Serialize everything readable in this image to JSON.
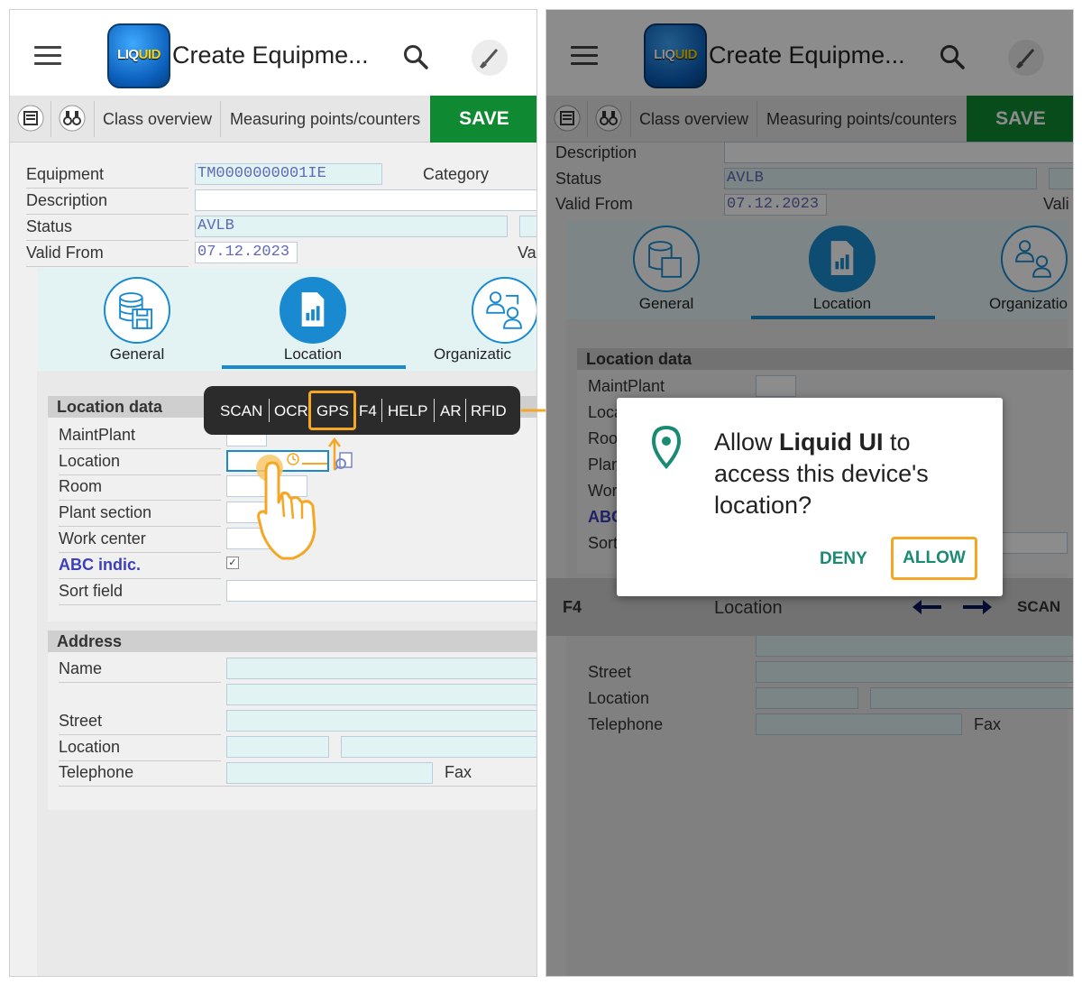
{
  "app": {
    "title": "Create Equipme...",
    "logo_text": "LIQUID"
  },
  "toolbar": {
    "class_overview": "Class overview",
    "measuring_points": "Measuring points/counters",
    "save_label": "SAVE"
  },
  "header_fields": {
    "equipment_label": "Equipment",
    "equipment_value": "TM0000000001IE",
    "category_label": "Category",
    "description_label": "Description",
    "status_label": "Status",
    "status_value": "AVLB",
    "valid_from_label": "Valid From",
    "valid_from_value": "07.12.2023",
    "valid_to_label_left": "Va",
    "valid_to_label_right": "Vali"
  },
  "tabs": [
    {
      "label": "General",
      "icon": "database-save-icon"
    },
    {
      "label": "Location",
      "icon": "document-chart-icon"
    },
    {
      "label": "Organizatic",
      "icon": "organization-icon"
    }
  ],
  "tabs_right": [
    {
      "label": "General"
    },
    {
      "label": "Location"
    },
    {
      "label": "Organizatio"
    }
  ],
  "location_data": {
    "header": "Location data",
    "maint_plant": "MaintPlant",
    "location": "Location",
    "room": "Room",
    "plant_section": "Plant section",
    "work_center": "Work center",
    "abc_indic": "ABC indic.",
    "sort_field": "Sort field"
  },
  "location_data_right": {
    "loc": "Loca",
    "room": "Roo",
    "plant": "Plan",
    "work": "Wor",
    "abc": "ABC",
    "sort": "Sort"
  },
  "address": {
    "header": "Address",
    "name": "Name",
    "street": "Street",
    "location": "Location",
    "telephone": "Telephone",
    "fax": "Fax"
  },
  "context_bar": {
    "items": [
      "SCAN",
      "OCR",
      "GPS",
      "F4",
      "HELP",
      "AR",
      "RFID"
    ]
  },
  "dialog": {
    "text_prefix": "Allow ",
    "app_name": "Liquid UI",
    "text_suffix": " to access this device's location?",
    "deny_label": "DENY",
    "allow_label": "ALLOW"
  },
  "f4_bar": {
    "f4": "F4",
    "title": "Location",
    "scan": "SCAN"
  },
  "colors": {
    "save_green": "#108a32",
    "accent_blue": "#1a8ad0",
    "highlight_orange": "#f5a623",
    "dialog_teal": "#1b8a73",
    "field_value_purple": "#6168b8"
  }
}
